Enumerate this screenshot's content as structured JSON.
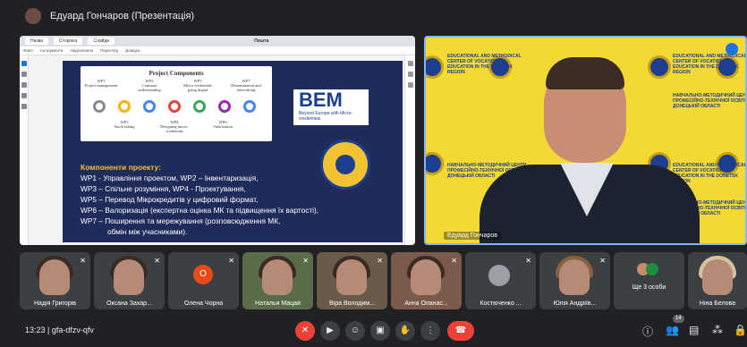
{
  "top": {
    "title": "Едуард Гончаров (Презентація)"
  },
  "share": {
    "tabs": [
      "Назва",
      "Сторінка",
      "Слайди"
    ],
    "ptitle": "Пошта",
    "menu": [
      "Файл",
      "Інструменти",
      "Надсилання",
      "Перегляд",
      "Довідка"
    ],
    "slide": {
      "pc_title": "Project Components",
      "wp_top": [
        {
          "code": "WP1",
          "label": "Project management"
        },
        {
          "code": "WP3",
          "label": "Common understanding"
        },
        {
          "code": "WP5",
          "label": "Micro-credentials going digital"
        },
        {
          "code": "WP7",
          "label": "Dissemination and networking"
        }
      ],
      "wp_bottom": [
        {
          "code": "WP2",
          "label": "Stock-taking"
        },
        {
          "code": "WP4",
          "label": "Designing micro-credentials"
        },
        {
          "code": "WP6",
          "label": "Valorization"
        }
      ],
      "bem_big": "BEM",
      "bem_sub": "Beyond Europe with Micro-credentials",
      "components_title": "Компоненти проекту:",
      "lines": [
        "WP1 - Управління проектом, WP2 – Інвентаризація,",
        "WP3 – Спільне розуміння, WP4 - Проектування,",
        "WP5 – Перевод Мікрокредитів у цифровий формат,",
        "WP6 – Валоризація (експертна оцінка МК та підвищення їх вартості),",
        "WP7 – Поширення та мережування (розповсюдження МК,",
        "обмін між учасниками)."
      ],
      "ring_colors": [
        "#8a8a8a",
        "#f4b400",
        "#4285f4",
        "#ea4335",
        "#34a853",
        "#9c27b0",
        "#4285f4"
      ]
    }
  },
  "video": {
    "banner_en": "EDUCATIONAL AND METHODICAL CENTER OF VOCATIONAL EDUCATION IN THE DONETSK REGION",
    "banner_ua": "НАВЧАЛЬНО-МЕТОДИЧНИЙ ЦЕНТР ПРОФЕСІЙНО-ТЕХНІЧНОЇ ОСВІТИ У ДОНЕЦЬКІЙ ОБЛАСТІ",
    "name": "Едуард Гончаров"
  },
  "participants": [
    {
      "name": "Надія Григорів"
    },
    {
      "name": "Оксана Захар..."
    },
    {
      "name": "Олена Чорна",
      "initial": "О"
    },
    {
      "name": "Наталья Мацай"
    },
    {
      "name": "Віра Володим..."
    },
    {
      "name": "Анна Опанас..."
    },
    {
      "name": "Костюченко ..."
    },
    {
      "name": "Юлія Андріїв..."
    },
    {
      "name": "Ще 3 особи"
    },
    {
      "name": "Ніна Белова"
    }
  ],
  "bottom": {
    "time": "13:23",
    "code": "gfa-dfzv-qfv",
    "people_count": "14"
  }
}
